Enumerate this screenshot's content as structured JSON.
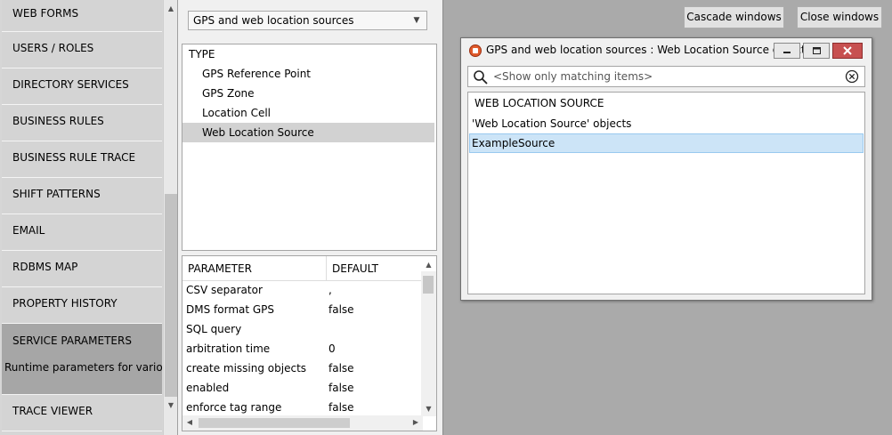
{
  "nav": {
    "items": [
      {
        "label": "WEB FORMS"
      },
      {
        "label": "USERS / ROLES"
      },
      {
        "label": "DIRECTORY SERVICES"
      },
      {
        "label": "BUSINESS RULES"
      },
      {
        "label": "BUSINESS RULE TRACE"
      },
      {
        "label": "SHIFT PATTERNS"
      },
      {
        "label": "EMAIL"
      },
      {
        "label": "RDBMS MAP"
      },
      {
        "label": "PROPERTY HISTORY"
      },
      {
        "label": "SERVICE PARAMETERS",
        "description": "Runtime parameters for various services",
        "active": true
      },
      {
        "label": "TRACE VIEWER"
      }
    ]
  },
  "type_selector": {
    "selected": "GPS and web location sources"
  },
  "type_list": {
    "header": "TYPE",
    "items": [
      {
        "label": "GPS Reference Point"
      },
      {
        "label": "GPS Zone"
      },
      {
        "label": "Location Cell"
      },
      {
        "label": "Web Location Source",
        "selected": true
      }
    ]
  },
  "parameters": {
    "columns": [
      "PARAMETER",
      "DEFAULT"
    ],
    "rows": [
      {
        "name": "CSV separator",
        "default": ","
      },
      {
        "name": "DMS format GPS",
        "default": "false"
      },
      {
        "name": "SQL query",
        "default": ""
      },
      {
        "name": "arbitration time",
        "default": "0"
      },
      {
        "name": "create missing objects",
        "default": "false"
      },
      {
        "name": "enabled",
        "default": "false"
      },
      {
        "name": "enforce tag range",
        "default": "false"
      }
    ]
  },
  "workspace": {
    "cascade_label": "Cascade windows",
    "close_label": "Close windows"
  },
  "window": {
    "title": "GPS and web location sources : Web Location Source objects",
    "search_placeholder": "<Show only matching items>",
    "list_header": "WEB LOCATION SOURCE",
    "items": [
      {
        "label": "'Web Location Source' objects"
      },
      {
        "label": "ExampleSource",
        "selected": true
      }
    ]
  },
  "colors": {
    "workspace_bg": "#aaaaaa",
    "nav_active_bg": "#a6a6a6",
    "list_selected_bg": "#cce4f7",
    "close_button": "#c75050"
  }
}
